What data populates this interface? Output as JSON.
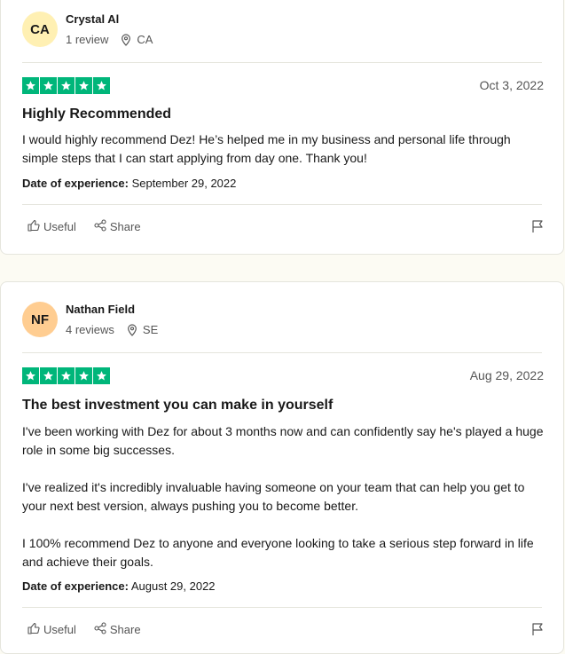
{
  "reviews": [
    {
      "initials": "CA",
      "avatar_color": "#fff0b3",
      "name": "Crystal Al",
      "review_count": "1 review",
      "country": "CA",
      "rating": 5,
      "date": "Oct 3, 2022",
      "title": "Highly Recommended",
      "paragraphs": [
        "I would highly recommend Dez! He’s helped me in my business and personal life through simple steps that I can start applying from day one. Thank you!"
      ],
      "experience_label": "Date of experience:",
      "experience_date": "September 29, 2022",
      "useful_label": "Useful",
      "share_label": "Share"
    },
    {
      "initials": "NF",
      "avatar_color": "#ffcd91",
      "name": "Nathan Field",
      "review_count": "4 reviews",
      "country": "SE",
      "rating": 5,
      "date": "Aug 29, 2022",
      "title": "The best investment you can make in yourself",
      "paragraphs": [
        "I've been working with Dez for about 3 months now and can confidently say he's played a huge role in some big successes.",
        "I've realized it's incredibly invaluable having someone on your team that can help you get to your next best version, always pushing you to become better.",
        "I 100% recommend Dez to anyone and everyone looking to take a serious step forward in life and achieve their goals."
      ],
      "experience_label": "Date of experience:",
      "experience_date": "August 29, 2022",
      "useful_label": "Useful",
      "share_label": "Share"
    }
  ],
  "colors": {
    "star_green": "#00b67a",
    "page_background": "#fcfbf3"
  },
  "icons": [
    "location-pin-icon",
    "star-icon",
    "thumbs-up-icon",
    "share-icon",
    "flag-icon"
  ]
}
